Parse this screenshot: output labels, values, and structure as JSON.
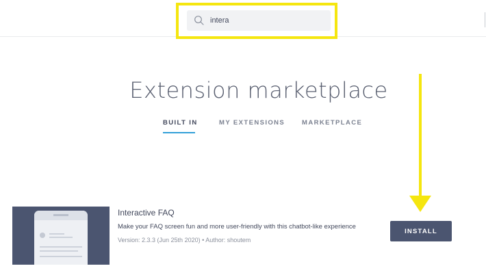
{
  "search": {
    "value": "intera",
    "icon": "search-icon"
  },
  "page": {
    "title": "Extension marketplace"
  },
  "tabs": [
    {
      "label": "BUILT IN",
      "active": true
    },
    {
      "label": "MY EXTENSIONS",
      "active": false
    },
    {
      "label": "MARKETPLACE",
      "active": false
    }
  ],
  "extension": {
    "name": "Interactive FAQ",
    "description": "Make your FAQ screen fun and more user-friendly with this chatbot-like experience",
    "meta": "Version: 2.3.3 (Jun 25th 2020) • Author: shoutem",
    "install_label": "INSTALL"
  },
  "colors": {
    "highlight": "#f5e60f",
    "tab_active_underline": "#2f9fd8",
    "button": "#4b5570"
  }
}
